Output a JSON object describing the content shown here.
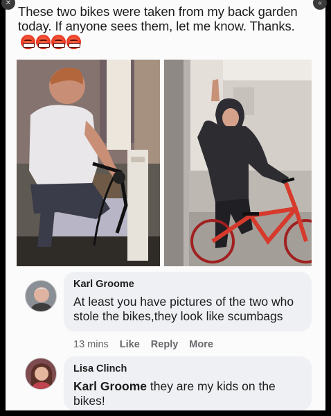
{
  "post": {
    "text": "These two bikes were taken from my back garden today. If anyone sees them, let me know. Thanks.",
    "emoji_count": 4,
    "emoji_name": "angry-face-icon"
  },
  "photos": [
    {
      "name": "photo-left"
    },
    {
      "name": "photo-right"
    }
  ],
  "comments": [
    {
      "author": "Karl Groome",
      "text": "At least you have pictures of the two who stole the bikes,they look like scumbags",
      "time": "13 mins",
      "like": "Like",
      "reply": "Reply",
      "more": "More"
    },
    {
      "author": "Lisa Clinch",
      "mention": "Karl Groome",
      "text": " they are my kids on the bikes!"
    }
  ],
  "colors": {
    "background": "#fbfbfb",
    "bubble": "#eef0f3",
    "text": "#1c1c1c",
    "meta": "#65676b",
    "emoji": "#e53520"
  }
}
